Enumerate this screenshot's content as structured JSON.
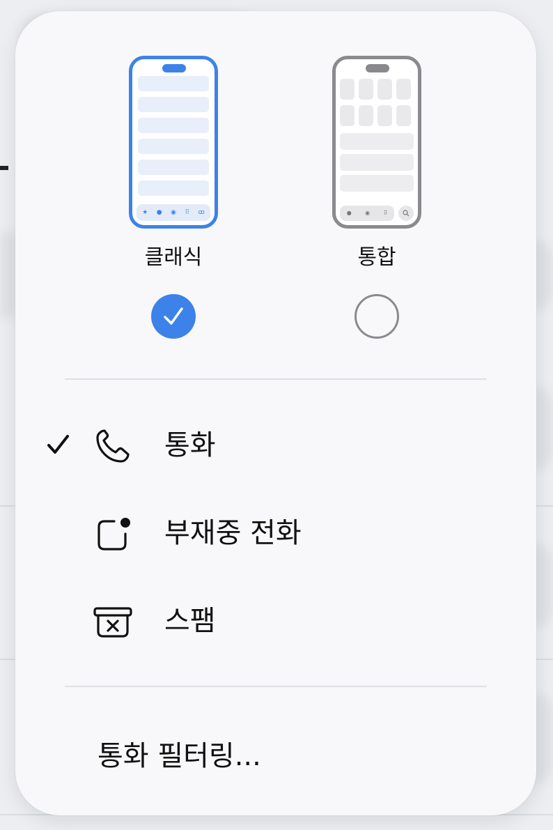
{
  "layout_options": {
    "classic": {
      "label": "클래식",
      "selected": true
    },
    "unified": {
      "label": "통합",
      "selected": false
    }
  },
  "menu_items": [
    {
      "label": "통화",
      "checked": true,
      "icon": "phone-icon"
    },
    {
      "label": "부재중 전화",
      "checked": false,
      "icon": "missed-call-icon"
    },
    {
      "label": "스팸",
      "checked": false,
      "icon": "spam-box-icon"
    }
  ],
  "filter_item": {
    "label": "통화 필터링..."
  },
  "colors": {
    "accent": "#3c82e8",
    "unselected": "#8a8a8e",
    "menu_background": "#f8f8fa",
    "divider": "#dedfe3"
  }
}
